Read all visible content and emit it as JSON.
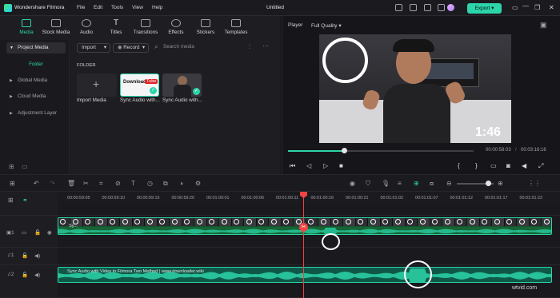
{
  "app": {
    "name": "Wondershare Filmora",
    "document_title": "Untitled",
    "export_label": "Export"
  },
  "menu": [
    "File",
    "Edit",
    "Tools",
    "View",
    "Help"
  ],
  "library_tabs": [
    {
      "label": "Media",
      "icon": "media-icon",
      "active": true
    },
    {
      "label": "Stock Media",
      "icon": "stock-media-icon",
      "active": false
    },
    {
      "label": "Audio",
      "icon": "audio-icon",
      "active": false
    },
    {
      "label": "Titles",
      "icon": "titles-icon",
      "active": false
    },
    {
      "label": "Transitions",
      "icon": "transitions-icon",
      "active": false
    },
    {
      "label": "Effects",
      "icon": "effects-icon",
      "active": false
    },
    {
      "label": "Stickers",
      "icon": "stickers-icon",
      "active": false
    },
    {
      "label": "Templates",
      "icon": "templates-icon",
      "active": false
    }
  ],
  "sidebar": {
    "project_media": "Project Media",
    "folder": "Folder",
    "items": [
      "Global Media",
      "Cloud Media",
      "Adjustment Layer"
    ]
  },
  "library": {
    "import_label": "Import",
    "record_label": "Record",
    "search_placeholder": "Search media",
    "folder_heading": "FOLDER",
    "import_media_label": "Import Media",
    "thumbnail_badge": "Download",
    "thumbnail_badge_brand": "Tube",
    "items": [
      "Sync Audio with...",
      "Sync Audio with..."
    ]
  },
  "player": {
    "tab_label": "Player",
    "quality": "Full Quality",
    "overlay_timecode": "1:46",
    "current_time": "00:00:58:03",
    "total_time": "00:03:16:16",
    "progress": 0.3
  },
  "timeline": {
    "ruler_labels": [
      "00:00:59:05",
      "00:00:59:10",
      "00:00:59:15",
      "00:00:59:20",
      "00:01:00:01",
      "00:01:00:06",
      "00:01:00:11",
      "00:01:00:16",
      "00:01:00:21",
      "00:01:01:02",
      "00:01:01:07",
      "00:01:01:12",
      "00:01:01:17",
      "00:01:01:22"
    ],
    "video_track_label": "1",
    "audio_track_1_label": "1",
    "audio_track_2_label": "2",
    "video_clip_label": "Sy...",
    "audio_clip_label": "Sync Audio with Video in Filmora Two Method | www.downloader.wiki"
  },
  "watermark": "wtvid.com",
  "colors": {
    "accent": "#2bd4a9",
    "playhead": "#ef4444",
    "background": "#18181b"
  }
}
